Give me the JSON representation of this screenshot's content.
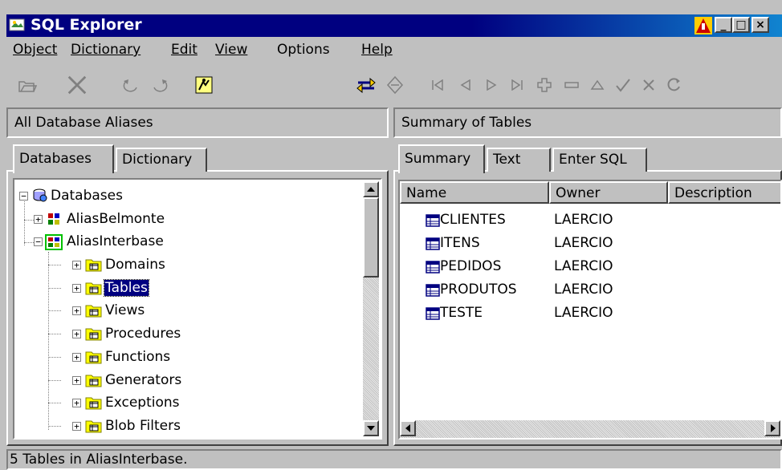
{
  "window": {
    "title": "SQL Explorer"
  },
  "menu": {
    "items": [
      {
        "label": "Object"
      },
      {
        "label": "Dictionary"
      },
      {
        "label": "Edit"
      },
      {
        "label": "View"
      },
      {
        "label": "Options"
      },
      {
        "label": "Help"
      }
    ]
  },
  "left": {
    "header": "All Database Aliases",
    "tabs": [
      "Databases",
      "Dictionary"
    ],
    "tree": {
      "root": "Databases",
      "aliases": [
        "AliasBelmonte",
        "AliasInterbase"
      ],
      "children": [
        "Domains",
        "Tables",
        "Views",
        "Procedures",
        "Functions",
        "Generators",
        "Exceptions",
        "Blob Filters"
      ],
      "selected": "Tables"
    }
  },
  "right": {
    "header": "Summary of Tables",
    "tabs": [
      "Summary",
      "Text",
      "Enter SQL"
    ],
    "columns": [
      "Name",
      "Owner",
      "Description"
    ],
    "rows": [
      {
        "name": "CLIENTES",
        "owner": "LAERCIO"
      },
      {
        "name": "ITENS",
        "owner": "LAERCIO"
      },
      {
        "name": "PEDIDOS",
        "owner": "LAERCIO"
      },
      {
        "name": "PRODUTOS",
        "owner": "LAERCIO"
      },
      {
        "name": "TESTE",
        "owner": "LAERCIO"
      }
    ]
  },
  "status": {
    "text": "5 Tables in AliasInterbase."
  },
  "colors": {
    "titlebar": "#000080",
    "selection": "#000080",
    "folder": "#ffff00"
  },
  "icons": [
    "open-icon",
    "delete-icon",
    "undo-icon",
    "redo-icon",
    "run-icon",
    "refresh-icon",
    "sync-icon",
    "first-icon",
    "prior-icon",
    "next-icon",
    "last-icon",
    "insert-icon",
    "remove-icon",
    "edit-icon",
    "post-icon",
    "cancel-icon",
    "reload-icon"
  ]
}
